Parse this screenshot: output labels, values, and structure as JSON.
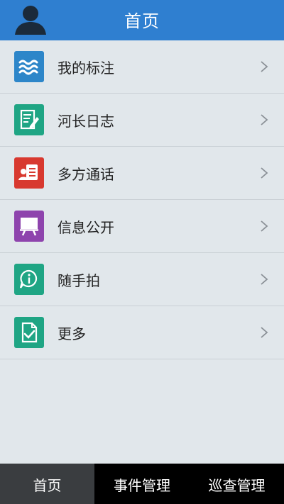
{
  "header": {
    "title": "首页",
    "bg_color": "#2f7fd0",
    "avatar_icon": "user-silhouette-icon"
  },
  "menu": {
    "items": [
      {
        "label": "我的标注",
        "icon": "waves-icon",
        "color": "#2d86c9"
      },
      {
        "label": "河长日志",
        "icon": "notepad-pen-icon",
        "color": "#1fa584"
      },
      {
        "label": "多方通话",
        "icon": "conference-card-icon",
        "color": "#d8392f"
      },
      {
        "label": "信息公开",
        "icon": "presentation-board-icon",
        "color": "#8e44ad"
      },
      {
        "label": "随手拍",
        "icon": "info-bubble-icon",
        "color": "#1fa584"
      },
      {
        "label": "更多",
        "icon": "document-check-icon",
        "color": "#1fa584"
      }
    ],
    "chevron_icon": "chevron-right-icon"
  },
  "tabs": {
    "items": [
      {
        "label": "首页",
        "active": true
      },
      {
        "label": "事件管理",
        "active": false
      },
      {
        "label": "巡查管理",
        "active": false
      }
    ]
  },
  "colors": {
    "background": "#e1e7eb",
    "divider": "#c9d0d5",
    "tabbar": "#000000",
    "tab_active": "#3a3d40"
  }
}
